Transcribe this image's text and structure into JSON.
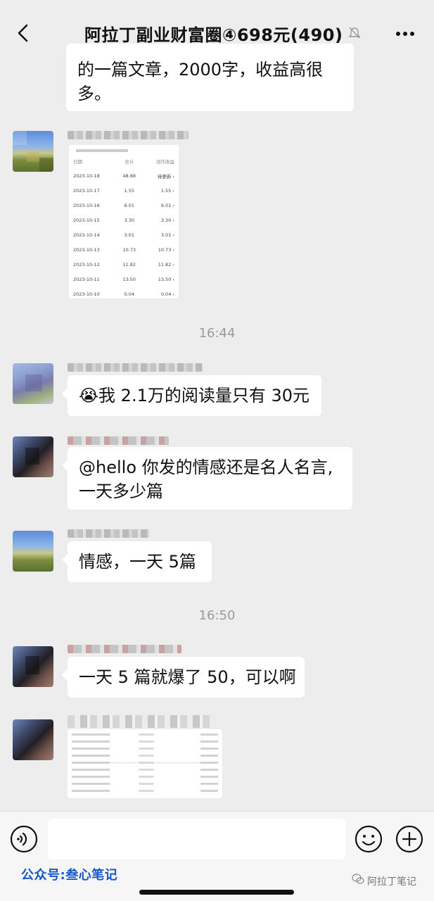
{
  "header": {
    "title": "阿拉丁副业财富圈④698元(490)",
    "back_icon": "chevron-left-icon",
    "mute_icon": "bell-off-icon",
    "more_icon": "more-dots-icon"
  },
  "messages": [
    {
      "id": "m1",
      "type": "text",
      "text": "的一篇文章，2000字，收益高很多。",
      "line1": "的一篇文章，2000字，收益高很",
      "line2": "多。"
    },
    {
      "id": "m2",
      "type": "image",
      "table": {
        "headers": [
          "日期",
          "总计",
          "创作收益"
        ],
        "rows": [
          [
            "2023-10-18",
            "48.88",
            "待更新 ›"
          ],
          [
            "2023-10-17",
            "1.55",
            "1.55 ›"
          ],
          [
            "2023-10-16",
            "6.01",
            "6.01 ›"
          ],
          [
            "2023-10-15",
            "3.30",
            "3.30 ›"
          ],
          [
            "2023-10-14",
            "3.01",
            "3.01 ›"
          ],
          [
            "2023-10-13",
            "10.73",
            "10.73 ›"
          ],
          [
            "2023-10-12",
            "11.82",
            "11.82 ›"
          ],
          [
            "2023-10-11",
            "13.50",
            "13.50 ›"
          ],
          [
            "2023-10-10",
            "0.04",
            "0.04 ›"
          ]
        ]
      }
    },
    {
      "id": "t1",
      "type": "time",
      "text": "16:44"
    },
    {
      "id": "m3",
      "type": "text",
      "emoji": "😭",
      "text": "我 2.1万的阅读量只有 30元"
    },
    {
      "id": "m4",
      "type": "text",
      "line1": "@hello 你发的情感还是名人名言,",
      "line2": "一天多少篇"
    },
    {
      "id": "m5",
      "type": "text",
      "text": "情感，一天 5篇"
    },
    {
      "id": "t2",
      "type": "time",
      "text": "16:50"
    },
    {
      "id": "m6",
      "type": "text",
      "text": "一天 5 篇就爆了 50，可以啊"
    },
    {
      "id": "m7",
      "type": "image"
    }
  ],
  "input": {
    "placeholder": "",
    "value": ""
  },
  "icons": {
    "voice": "voice-icon",
    "emoji": "emoji-icon",
    "plus": "plus-icon"
  },
  "watermark": {
    "left": "公众号:叁心笔记",
    "right": "阿拉丁笔记"
  },
  "colors": {
    "background": "#ededed",
    "bubble": "#ffffff",
    "watermark_blue": "#1557c6"
  }
}
